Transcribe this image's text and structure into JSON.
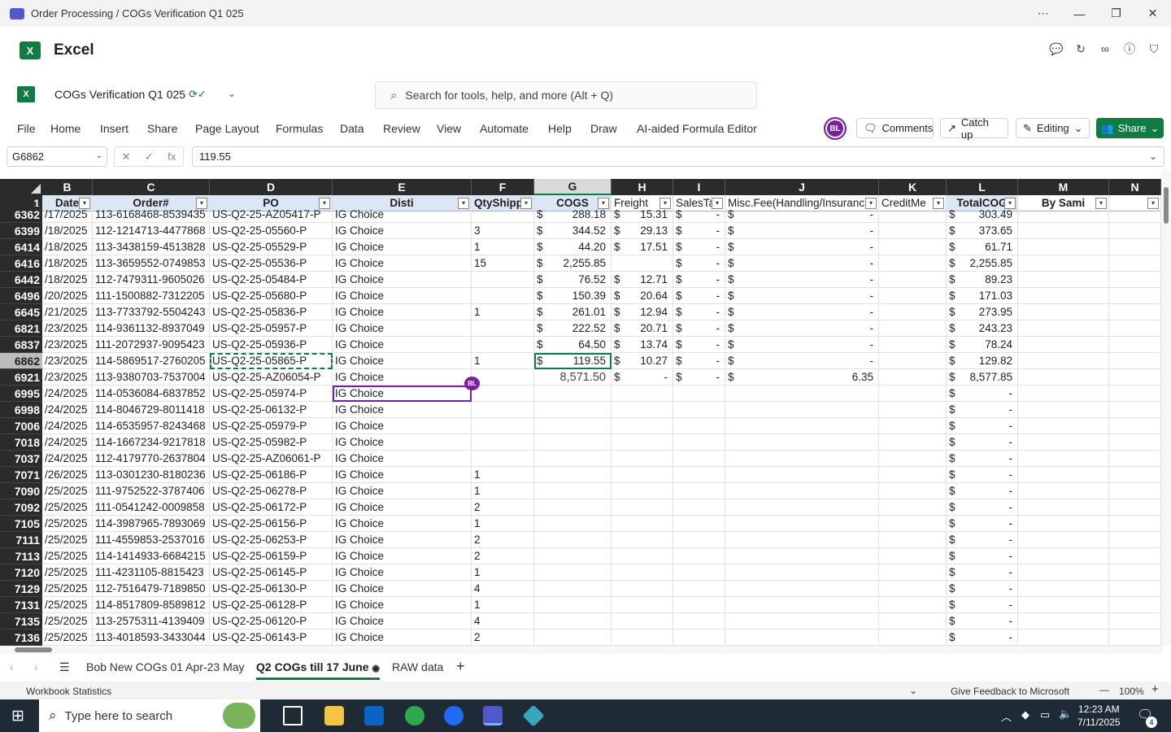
{
  "window": {
    "title": "Order Processing / COGs Verification Q1 025"
  },
  "app": {
    "name": "Excel",
    "logo": "X"
  },
  "doc": {
    "name": "COGs Verification Q1 025",
    "search_placeholder": "Search for tools, help, and more (Alt + Q)"
  },
  "menu": {
    "items": [
      "File",
      "Home",
      "Insert",
      "Share",
      "Page Layout",
      "Formulas",
      "Data",
      "Review",
      "View",
      "Automate",
      "Help",
      "Draw",
      "AI-aided Formula Editor"
    ],
    "avatar": "BL",
    "comments": "Comments",
    "catchup": "Catch up",
    "editing": "Editing",
    "share": "Share"
  },
  "formula_bar": {
    "namebox": "G6862",
    "value": "119.55",
    "fx": "fx"
  },
  "columns": [
    "B",
    "C",
    "D",
    "E",
    "F",
    "G",
    "H",
    "I",
    "J",
    "K",
    "L",
    "M",
    "N"
  ],
  "header_row": {
    "num": "1",
    "cells": [
      "Date",
      "Order#",
      "PO",
      "Disti",
      "QtyShipp",
      "COGS",
      "Freight",
      "SalesTa",
      "Misc.Fee(Handling/Insuranc",
      "CreditMe",
      "TotalCOG",
      "By Sami",
      ""
    ]
  },
  "rows": [
    {
      "n": "6362",
      "date": "/17/2025",
      "order": "113-6168468-8539435",
      "po": "US-Q2-25-AZ05417-P",
      "disti": "IG Choice",
      "qty": "",
      "cogs": "288.18",
      "cogs_cur": "$",
      "freight": "15.31",
      "fr_cur": "$",
      "tax": "-",
      "tax_cur": "$",
      "misc": "-",
      "misc_cur": "$",
      "total": "303.49",
      "tot_cur": "$"
    },
    {
      "n": "6399",
      "date": "/18/2025",
      "order": "112-1214713-4477868",
      "po": "US-Q2-25-05560-P",
      "disti": "IG Choice",
      "qty": "3",
      "cogs": "344.52",
      "cogs_cur": "$",
      "freight": "29.13",
      "fr_cur": "$",
      "tax": "-",
      "tax_cur": "$",
      "misc": "-",
      "misc_cur": "$",
      "total": "373.65",
      "tot_cur": "$"
    },
    {
      "n": "6414",
      "date": "/18/2025",
      "order": "113-3438159-4513828",
      "po": "US-Q2-25-05529-P",
      "disti": "IG Choice",
      "qty": "1",
      "cogs": "44.20",
      "cogs_cur": "$",
      "freight": "17.51",
      "fr_cur": "$",
      "tax": "-",
      "tax_cur": "$",
      "misc": "-",
      "misc_cur": "$",
      "total": "61.71",
      "tot_cur": "$"
    },
    {
      "n": "6416",
      "date": "/18/2025",
      "order": "113-3659552-0749853",
      "po": "US-Q2-25-05536-P",
      "disti": "IG Choice",
      "qty": "15",
      "cogs": "2,255.85",
      "cogs_cur": "$",
      "freight": "",
      "fr_cur": "",
      "tax": "-",
      "tax_cur": "$",
      "misc": "-",
      "misc_cur": "$",
      "total": "2,255.85",
      "tot_cur": "$"
    },
    {
      "n": "6442",
      "date": "/18/2025",
      "order": "112-7479311-9605026",
      "po": "US-Q2-25-05484-P",
      "disti": "IG Choice",
      "qty": "",
      "cogs": "76.52",
      "cogs_cur": "$",
      "freight": "12.71",
      "fr_cur": "$",
      "tax": "-",
      "tax_cur": "$",
      "misc": "-",
      "misc_cur": "$",
      "total": "89.23",
      "tot_cur": "$"
    },
    {
      "n": "6496",
      "date": "/20/2025",
      "order": "111-1500882-7312205",
      "po": "US-Q2-25-05680-P",
      "disti": "IG Choice",
      "qty": "",
      "cogs": "150.39",
      "cogs_cur": "$",
      "freight": "20.64",
      "fr_cur": "$",
      "tax": "-",
      "tax_cur": "$",
      "misc": "-",
      "misc_cur": "$",
      "total": "171.03",
      "tot_cur": "$"
    },
    {
      "n": "6645",
      "date": "/21/2025",
      "order": "113-7733792-5504243",
      "po": "US-Q2-25-05836-P",
      "disti": "IG Choice",
      "qty": "1",
      "cogs": "261.01",
      "cogs_cur": "$",
      "freight": "12.94",
      "fr_cur": "$",
      "tax": "-",
      "tax_cur": "$",
      "misc": "-",
      "misc_cur": "$",
      "total": "273.95",
      "tot_cur": "$"
    },
    {
      "n": "6821",
      "date": "/23/2025",
      "order": "114-9361132-8937049",
      "po": "US-Q2-25-05957-P",
      "disti": "IG Choice",
      "qty": "",
      "cogs": "222.52",
      "cogs_cur": "$",
      "freight": "20.71",
      "fr_cur": "$",
      "tax": "-",
      "tax_cur": "$",
      "misc": "-",
      "misc_cur": "$",
      "total": "243.23",
      "tot_cur": "$"
    },
    {
      "n": "6837",
      "date": "/23/2025",
      "order": "111-2072937-9095423",
      "po": "US-Q2-25-05936-P",
      "disti": "IG Choice",
      "qty": "",
      "cogs": "64.50",
      "cogs_cur": "$",
      "freight": "13.74",
      "fr_cur": "$",
      "tax": "-",
      "tax_cur": "$",
      "misc": "-",
      "misc_cur": "$",
      "total": "78.24",
      "tot_cur": "$"
    },
    {
      "n": "6862",
      "date": "/23/2025",
      "order": "114-5869517-2760205",
      "po": "US-Q2-25-05865-P",
      "disti": "IG Choice",
      "qty": "1",
      "cogs": "119.55",
      "cogs_cur": "$",
      "freight": "10.27",
      "fr_cur": "$",
      "tax": "-",
      "tax_cur": "$",
      "misc": "-",
      "misc_cur": "$",
      "total": "129.82",
      "tot_cur": "$"
    },
    {
      "n": "6921",
      "date": "/23/2025",
      "order": "113-9380703-7537004",
      "po": "US-Q2-25-AZ06054-P",
      "disti": "IG Choice",
      "qty": "",
      "cogs": "8,571.50",
      "cogs_cur": "",
      "freight": "-",
      "fr_cur": "$",
      "tax": "-",
      "tax_cur": "$",
      "misc": "6.35",
      "misc_cur": "$",
      "total": "8,577.85",
      "tot_cur": "$"
    },
    {
      "n": "6995",
      "date": "/24/2025",
      "order": "114-0536084-6837852",
      "po": "US-Q2-25-05974-P",
      "disti": "IG Choice",
      "qty": "",
      "cogs": "",
      "cogs_cur": "",
      "freight": "",
      "fr_cur": "",
      "tax": "",
      "tax_cur": "",
      "misc": "",
      "misc_cur": "",
      "total": "-",
      "tot_cur": "$"
    },
    {
      "n": "6998",
      "date": "/24/2025",
      "order": "114-8046729-8011418",
      "po": "US-Q2-25-06132-P",
      "disti": "IG Choice",
      "qty": "",
      "cogs": "",
      "cogs_cur": "",
      "freight": "",
      "fr_cur": "",
      "tax": "",
      "tax_cur": "",
      "misc": "",
      "misc_cur": "",
      "total": "-",
      "tot_cur": "$"
    },
    {
      "n": "7006",
      "date": "/24/2025",
      "order": "114-6535957-8243468",
      "po": "US-Q2-25-05979-P",
      "disti": "IG Choice",
      "qty": "",
      "cogs": "",
      "cogs_cur": "",
      "freight": "",
      "fr_cur": "",
      "tax": "",
      "tax_cur": "",
      "misc": "",
      "misc_cur": "",
      "total": "-",
      "tot_cur": "$"
    },
    {
      "n": "7018",
      "date": "/24/2025",
      "order": "114-1667234-9217818",
      "po": "US-Q2-25-05982-P",
      "disti": "IG Choice",
      "qty": "",
      "cogs": "",
      "cogs_cur": "",
      "freight": "",
      "fr_cur": "",
      "tax": "",
      "tax_cur": "",
      "misc": "",
      "misc_cur": "",
      "total": "-",
      "tot_cur": "$"
    },
    {
      "n": "7037",
      "date": "/24/2025",
      "order": "112-4179770-2637804",
      "po": "US-Q2-25-AZ06061-P",
      "disti": "IG Choice",
      "qty": "",
      "cogs": "",
      "cogs_cur": "",
      "freight": "",
      "fr_cur": "",
      "tax": "",
      "tax_cur": "",
      "misc": "",
      "misc_cur": "",
      "total": "-",
      "tot_cur": "$"
    },
    {
      "n": "7071",
      "date": "/26/2025",
      "order": "113-0301230-8180236",
      "po": "US-Q2-25-06186-P",
      "disti": "IG Choice",
      "qty": "1",
      "cogs": "",
      "cogs_cur": "",
      "freight": "",
      "fr_cur": "",
      "tax": "",
      "tax_cur": "",
      "misc": "",
      "misc_cur": "",
      "total": "-",
      "tot_cur": "$"
    },
    {
      "n": "7090",
      "date": "/25/2025",
      "order": "111-9752522-3787406",
      "po": "US-Q2-25-06278-P",
      "disti": "IG Choice",
      "qty": "1",
      "cogs": "",
      "cogs_cur": "",
      "freight": "",
      "fr_cur": "",
      "tax": "",
      "tax_cur": "",
      "misc": "",
      "misc_cur": "",
      "total": "-",
      "tot_cur": "$"
    },
    {
      "n": "7092",
      "date": "/25/2025",
      "order": "111-0541242-0009858",
      "po": "US-Q2-25-06172-P",
      "disti": "IG Choice",
      "qty": "2",
      "cogs": "",
      "cogs_cur": "",
      "freight": "",
      "fr_cur": "",
      "tax": "",
      "tax_cur": "",
      "misc": "",
      "misc_cur": "",
      "total": "-",
      "tot_cur": "$"
    },
    {
      "n": "7105",
      "date": "/25/2025",
      "order": "114-3987965-7893069",
      "po": "US-Q2-25-06156-P",
      "disti": "IG Choice",
      "qty": "1",
      "cogs": "",
      "cogs_cur": "",
      "freight": "",
      "fr_cur": "",
      "tax": "",
      "tax_cur": "",
      "misc": "",
      "misc_cur": "",
      "total": "-",
      "tot_cur": "$"
    },
    {
      "n": "7111",
      "date": "/25/2025",
      "order": "111-4559853-2537016",
      "po": "US-Q2-25-06253-P",
      "disti": "IG Choice",
      "qty": "2",
      "cogs": "",
      "cogs_cur": "",
      "freight": "",
      "fr_cur": "",
      "tax": "",
      "tax_cur": "",
      "misc": "",
      "misc_cur": "",
      "total": "-",
      "tot_cur": "$"
    },
    {
      "n": "7113",
      "date": "/25/2025",
      "order": "114-1414933-6684215",
      "po": "US-Q2-25-06159-P",
      "disti": "IG Choice",
      "qty": "2",
      "cogs": "",
      "cogs_cur": "",
      "freight": "",
      "fr_cur": "",
      "tax": "",
      "tax_cur": "",
      "misc": "",
      "misc_cur": "",
      "total": "-",
      "tot_cur": "$"
    },
    {
      "n": "7120",
      "date": "/25/2025",
      "order": "111-4231105-8815423",
      "po": "US-Q2-25-06145-P",
      "disti": "IG Choice",
      "qty": "1",
      "cogs": "",
      "cogs_cur": "",
      "freight": "",
      "fr_cur": "",
      "tax": "",
      "tax_cur": "",
      "misc": "",
      "misc_cur": "",
      "total": "-",
      "tot_cur": "$"
    },
    {
      "n": "7129",
      "date": "/25/2025",
      "order": "112-7516479-7189850",
      "po": "US-Q2-25-06130-P",
      "disti": "IG Choice",
      "qty": "4",
      "cogs": "",
      "cogs_cur": "",
      "freight": "",
      "fr_cur": "",
      "tax": "",
      "tax_cur": "",
      "misc": "",
      "misc_cur": "",
      "total": "-",
      "tot_cur": "$"
    },
    {
      "n": "7131",
      "date": "/25/2025",
      "order": "114-8517809-8589812",
      "po": "US-Q2-25-06128-P",
      "disti": "IG Choice",
      "qty": "1",
      "cogs": "",
      "cogs_cur": "",
      "freight": "",
      "fr_cur": "",
      "tax": "",
      "tax_cur": "",
      "misc": "",
      "misc_cur": "",
      "total": "-",
      "tot_cur": "$"
    },
    {
      "n": "7135",
      "date": "/25/2025",
      "order": "113-2575311-4139409",
      "po": "US-Q2-25-06120-P",
      "disti": "IG Choice",
      "qty": "4",
      "cogs": "",
      "cogs_cur": "",
      "freight": "",
      "fr_cur": "",
      "tax": "",
      "tax_cur": "",
      "misc": "",
      "misc_cur": "",
      "total": "-",
      "tot_cur": "$"
    },
    {
      "n": "7136",
      "date": "/25/2025",
      "order": "113-4018593-3433044",
      "po": "US-Q2-25-06143-P",
      "disti": "IG Choice",
      "qty": "2",
      "cogs": "",
      "cogs_cur": "",
      "freight": "",
      "fr_cur": "",
      "tax": "",
      "tax_cur": "",
      "misc": "",
      "misc_cur": "",
      "total": "-",
      "tot_cur": "$"
    }
  ],
  "sheets": {
    "tabs": [
      "Bob New COGs 01 Apr-23 May",
      "Q2 COGs till 17 June",
      "RAW data"
    ],
    "add": "+"
  },
  "status": {
    "left": "Workbook Statistics",
    "feedback": "Give Feedback to Microsoft",
    "zoom": "100%"
  },
  "taskbar": {
    "search": "Type here to search",
    "time": "12:23 AM",
    "date": "7/11/2025",
    "notifications": "4"
  },
  "colors": {
    "accent": "#107c41",
    "presence": "#7a1fa2"
  }
}
